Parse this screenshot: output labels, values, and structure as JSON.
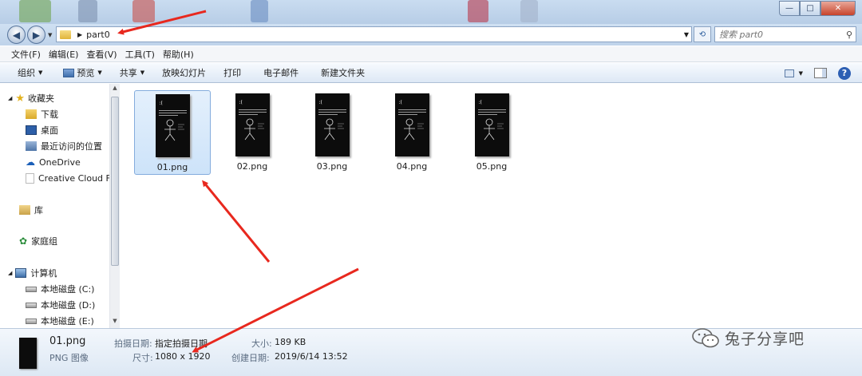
{
  "window": {
    "close": "✕",
    "minimize": "—",
    "maximize": "□"
  },
  "address": {
    "current": "part0"
  },
  "search": {
    "placeholder": "搜索 part0"
  },
  "menu": [
    "文件(F)",
    "编辑(E)",
    "查看(V)",
    "工具(T)",
    "帮助(H)"
  ],
  "toolbar": {
    "organize": "组织",
    "preview": "预览",
    "share": "共享",
    "slideshow": "放映幻灯片",
    "print": "打印",
    "email": "电子邮件",
    "new_folder": "新建文件夹"
  },
  "sidebar": {
    "favorites": "收藏夹",
    "downloads": "下载",
    "desktop": "桌面",
    "recent": "最近访问的位置",
    "onedrive": "OneDrive",
    "creative_cloud": "Creative Cloud F",
    "libraries": "库",
    "homegroup": "家庭组",
    "computer": "计算机",
    "drive_c": "本地磁盘 (C:)",
    "drive_d": "本地磁盘 (D:)",
    "drive_e": "本地磁盘 (E:)"
  },
  "files": [
    {
      "name": "01.png",
      "selected": true
    },
    {
      "name": "02.png",
      "selected": false
    },
    {
      "name": "03.png",
      "selected": false
    },
    {
      "name": "04.png",
      "selected": false
    },
    {
      "name": "05.png",
      "selected": false
    }
  ],
  "details": {
    "filename": "01.png",
    "type": "PNG 图像",
    "date_taken_label": "拍摄日期:",
    "date_taken_value": "指定拍摄日期",
    "dimensions_label": "尺寸:",
    "dimensions_value": "1080 x 1920",
    "size_label": "大小:",
    "size_value": "189 KB",
    "created_label": "创建日期:",
    "created_value": "2019/6/14 13:52"
  },
  "thumbnail": {
    "emoticon": ":("
  },
  "watermark": {
    "text": "兔子分享吧"
  },
  "colors": {
    "annotation_arrow": "#e8281e",
    "selection": "#cde3f9"
  }
}
